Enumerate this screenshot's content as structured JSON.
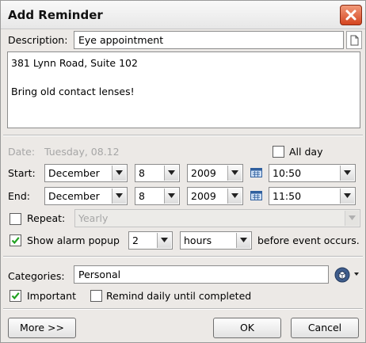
{
  "window": {
    "title": "Add Reminder"
  },
  "description": {
    "label": "Description:",
    "value": "Eye appointment"
  },
  "notes": {
    "lines": [
      "381 Lynn Road, Suite 102",
      "",
      "Bring old contact lenses!"
    ]
  },
  "date": {
    "label": "Date:",
    "value": "Tuesday, 08.12"
  },
  "all_day": {
    "label": "All day",
    "checked": false
  },
  "start": {
    "label": "Start:",
    "month": "December",
    "day": "8",
    "year": "2009",
    "time": "10:50"
  },
  "end": {
    "label": "End:",
    "month": "December",
    "day": "8",
    "year": "2009",
    "time": "11:50"
  },
  "repeat": {
    "label": "Repeat:",
    "checked": false,
    "value": "Yearly"
  },
  "alarm": {
    "label": "Show alarm popup",
    "checked": true,
    "amount": "2",
    "unit": "hours",
    "suffix": "before event occurs."
  },
  "categories": {
    "label": "Categories:",
    "value": "Personal"
  },
  "important": {
    "label": "Important",
    "checked": true
  },
  "remind_daily": {
    "label": "Remind daily until completed",
    "checked": false
  },
  "buttons": {
    "more": "More >>",
    "ok": "OK",
    "cancel": "Cancel"
  },
  "icons": {
    "close": "close-icon",
    "document": "document-icon",
    "calendar": "calendar-icon",
    "category": "category-icon",
    "dropdown": "chevron-down-icon",
    "check": "check-icon"
  }
}
